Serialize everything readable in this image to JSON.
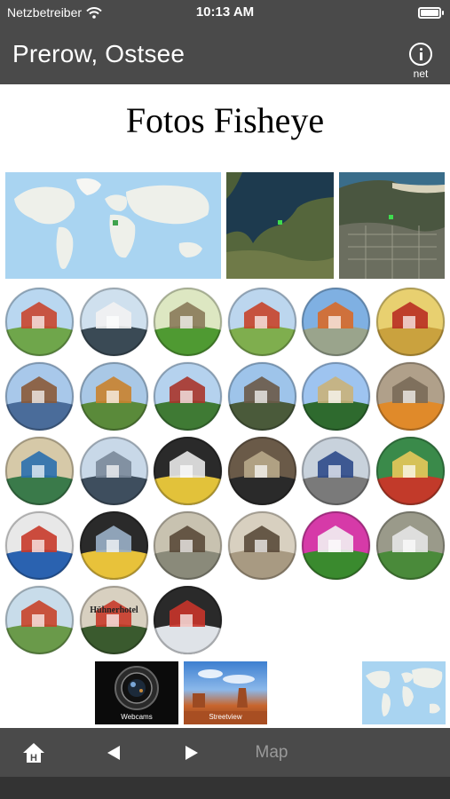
{
  "status": {
    "carrier": "Netzbetreiber",
    "time": "10:13 AM"
  },
  "nav": {
    "title": "Prerow, Ostsee",
    "info_sub": "net"
  },
  "page": {
    "title": "Fotos Fisheye"
  },
  "photos": [
    {
      "id": 1
    },
    {
      "id": 2
    },
    {
      "id": 3
    },
    {
      "id": 4
    },
    {
      "id": 5
    },
    {
      "id": 6
    },
    {
      "id": 7
    },
    {
      "id": 8
    },
    {
      "id": 9
    },
    {
      "id": 10
    },
    {
      "id": 11
    },
    {
      "id": 12
    },
    {
      "id": 13
    },
    {
      "id": 14
    },
    {
      "id": 15
    },
    {
      "id": 16
    },
    {
      "id": 17
    },
    {
      "id": 18
    },
    {
      "id": 19
    },
    {
      "id": 20
    },
    {
      "id": 21
    },
    {
      "id": 22
    },
    {
      "id": 23
    },
    {
      "id": 24
    },
    {
      "id": 25
    },
    {
      "id": 26
    },
    {
      "id": 27
    }
  ],
  "photo_signs": {
    "huhnerhotel": "Hühnerhotel"
  },
  "thumbs": {
    "webcams_label": "Webcams",
    "streetview_label": "Streetview"
  },
  "tabbar": {
    "map_label": "Map"
  },
  "colors": {
    "bars": "#4a4a4a",
    "map_label": "#9a9a9a"
  }
}
